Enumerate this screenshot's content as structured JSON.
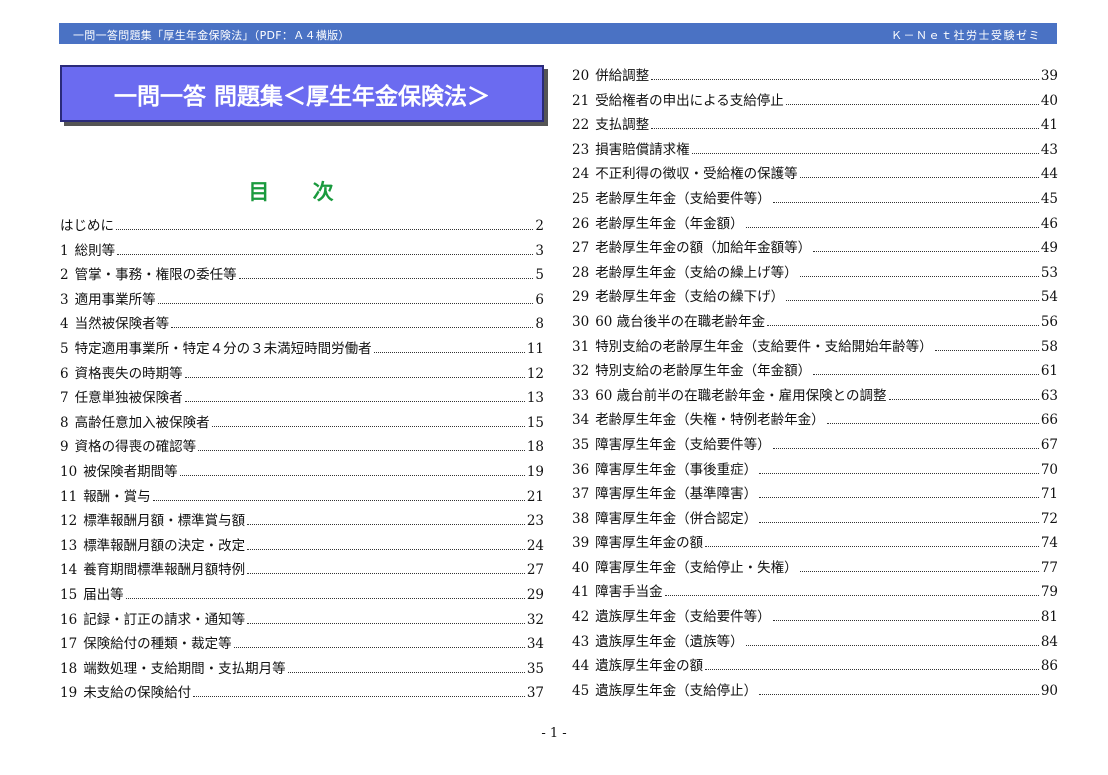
{
  "header": {
    "left": "一問一答問題集「厚生年金保険法」（PDF：Ａ４横版）",
    "right": "Ｋ－Ｎｅｔ社労士受験ゼミ"
  },
  "title": "一問一答 問題集＜厚生年金保険法＞",
  "toc_heading": "目 次",
  "left_entries": [
    {
      "num": "",
      "label": "はじめに",
      "page": "2"
    },
    {
      "num": "1",
      "label": "総則等",
      "page": "3"
    },
    {
      "num": "2",
      "label": "管掌・事務・権限の委任等",
      "page": "5"
    },
    {
      "num": "3",
      "label": "適用事業所等",
      "page": "6"
    },
    {
      "num": "4",
      "label": "当然被保険者等",
      "page": "8"
    },
    {
      "num": "5",
      "label": "特定適用事業所・特定４分の３未満短時間労働者",
      "page": "11"
    },
    {
      "num": "6",
      "label": "資格喪失の時期等",
      "page": "12"
    },
    {
      "num": "7",
      "label": "任意単独被保険者",
      "page": "13"
    },
    {
      "num": "8",
      "label": "高齢任意加入被保険者",
      "page": "15"
    },
    {
      "num": "9",
      "label": "資格の得喪の確認等",
      "page": "18"
    },
    {
      "num": "10",
      "label": "被保険者期間等",
      "page": "19"
    },
    {
      "num": "11",
      "label": "報酬・賞与",
      "page": "21"
    },
    {
      "num": "12",
      "label": "標準報酬月額・標準賞与額",
      "page": "23"
    },
    {
      "num": "13",
      "label": "標準報酬月額の決定・改定",
      "page": "24"
    },
    {
      "num": "14",
      "label": "養育期間標準報酬月額特例",
      "page": "27"
    },
    {
      "num": "15",
      "label": "届出等",
      "page": "29"
    },
    {
      "num": "16",
      "label": "記録・訂正の請求・通知等",
      "page": "32"
    },
    {
      "num": "17",
      "label": "保険給付の種類・裁定等",
      "page": "34"
    },
    {
      "num": "18",
      "label": "端数処理・支給期間・支払期月等",
      "page": "35"
    },
    {
      "num": "19",
      "label": "未支給の保険給付",
      "page": "37"
    }
  ],
  "right_entries": [
    {
      "num": "20",
      "label": "併給調整",
      "page": "39"
    },
    {
      "num": "21",
      "label": "受給権者の申出による支給停止",
      "page": "40"
    },
    {
      "num": "22",
      "label": "支払調整",
      "page": "41"
    },
    {
      "num": "23",
      "label": "損害賠償請求権",
      "page": "43"
    },
    {
      "num": "24",
      "label": "不正利得の徴収・受給権の保護等",
      "page": "44"
    },
    {
      "num": "25",
      "label": "老齢厚生年金（支給要件等）",
      "page": "45"
    },
    {
      "num": "26",
      "label": "老齢厚生年金（年金額）",
      "page": "46"
    },
    {
      "num": "27",
      "label": "老齢厚生年金の額（加給年金額等）",
      "page": "49"
    },
    {
      "num": "28",
      "label": "老齢厚生年金（支給の繰上げ等）",
      "page": "53"
    },
    {
      "num": "29",
      "label": "老齢厚生年金（支給の繰下げ）",
      "page": "54"
    },
    {
      "num": "30",
      "label": "60 歳台後半の在職老齢年金",
      "page": "56"
    },
    {
      "num": "31",
      "label": "特別支給の老齢厚生年金（支給要件・支給開始年齢等）",
      "page": "58"
    },
    {
      "num": "32",
      "label": "特別支給の老齢厚生年金（年金額）",
      "page": "61"
    },
    {
      "num": "33",
      "label": "60 歳台前半の在職老齢年金・雇用保険との調整",
      "page": "63"
    },
    {
      "num": "34",
      "label": "老齢厚生年金（失権・特例老齢年金）",
      "page": "66"
    },
    {
      "num": "35",
      "label": "障害厚生年金（支給要件等）",
      "page": "67"
    },
    {
      "num": "36",
      "label": "障害厚生年金（事後重症）",
      "page": "70"
    },
    {
      "num": "37",
      "label": "障害厚生年金（基準障害）",
      "page": "71"
    },
    {
      "num": "38",
      "label": "障害厚生年金（併合認定）",
      "page": "72"
    },
    {
      "num": "39",
      "label": "障害厚生年金の額",
      "page": "74"
    },
    {
      "num": "40",
      "label": "障害厚生年金（支給停止・失権）",
      "page": "77"
    },
    {
      "num": "41",
      "label": "障害手当金",
      "page": "79"
    },
    {
      "num": "42",
      "label": "遺族厚生年金（支給要件等）",
      "page": "81"
    },
    {
      "num": "43",
      "label": "遺族厚生年金（遺族等）",
      "page": "84"
    },
    {
      "num": "44",
      "label": "遺族厚生年金の額",
      "page": "86"
    },
    {
      "num": "45",
      "label": "遺族厚生年金（支給停止）",
      "page": "90"
    }
  ],
  "footer": "- 1 -",
  "colors": {
    "header_bg": "#4a72c4",
    "title_bg": "#6b6bf0",
    "heading_green": "#1a9a3e"
  }
}
